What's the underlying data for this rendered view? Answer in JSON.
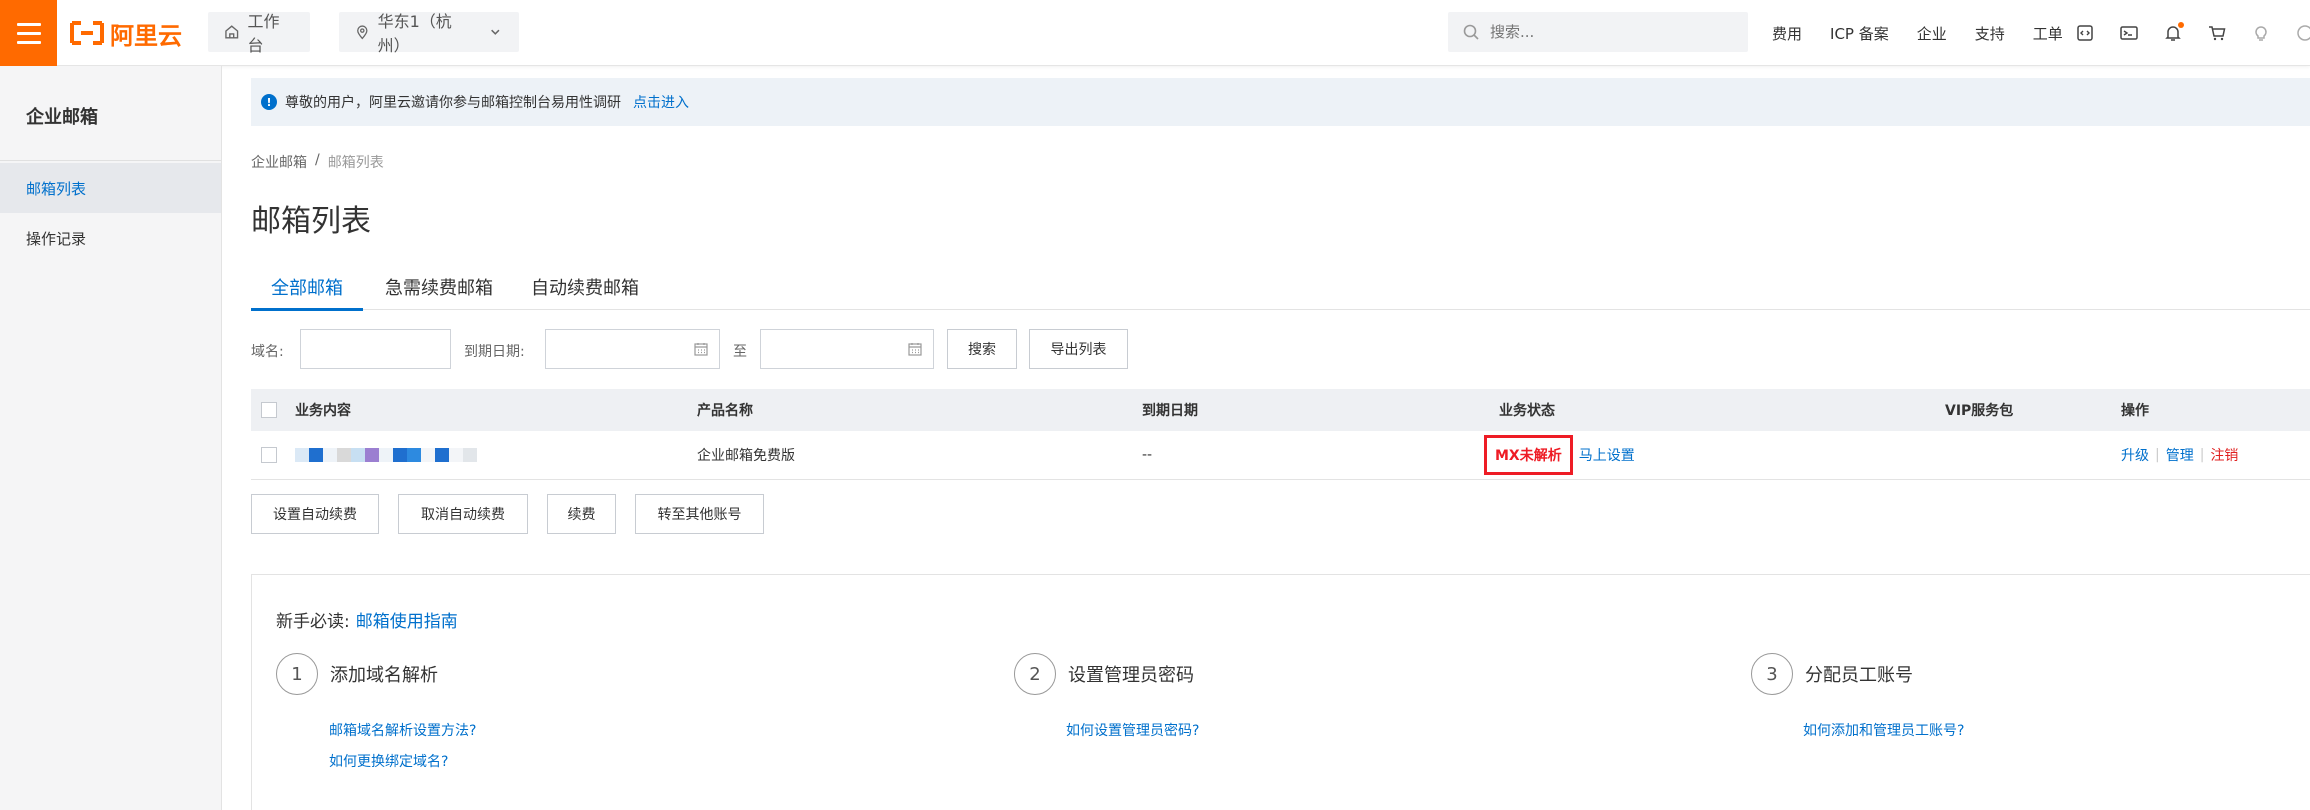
{
  "topbar": {
    "logo_text": "阿里云",
    "workbench": "工作台",
    "region": "华东1（杭州）",
    "search_placeholder": "搜索...",
    "links": [
      "费用",
      "ICP 备案",
      "企业",
      "支持",
      "工单"
    ],
    "icons": [
      "code-icon",
      "terminal-icon",
      "bell-icon",
      "cart-icon",
      "lightbulb-icon",
      "help-icon"
    ]
  },
  "sidebar": {
    "title": "企业邮箱",
    "items": [
      {
        "label": "邮箱列表",
        "active": true
      },
      {
        "label": "操作记录",
        "active": false
      }
    ]
  },
  "notice": {
    "text": "尊敬的用户，阿里云邀请你参与邮箱控制台易用性调研",
    "link": "点击进入"
  },
  "breadcrumb": [
    "企业邮箱",
    "邮箱列表"
  ],
  "page_title": "邮箱列表",
  "tabs": [
    {
      "label": "全部邮箱",
      "active": true
    },
    {
      "label": "急需续费邮箱",
      "active": false
    },
    {
      "label": "自动续费邮箱",
      "active": false
    }
  ],
  "filters": {
    "domain_label": "域名:",
    "domain_value": "",
    "expire_label": "到期日期:",
    "to_label": "至",
    "search_button": "搜索",
    "export_button": "导出列表"
  },
  "table": {
    "columns": [
      "业务内容",
      "产品名称",
      "到期日期",
      "业务状态",
      "VIP服务包",
      "操作"
    ],
    "rows": [
      {
        "product": "企业邮箱免费版",
        "expire": "--",
        "status": "MX未解析",
        "status_action": "马上设置",
        "vip": "",
        "actions": {
          "upgrade": "升级",
          "manage": "管理",
          "cancel": "注销"
        }
      }
    ]
  },
  "bulk_actions": [
    "设置自动续费",
    "取消自动续费",
    "续费",
    "转至其他账号"
  ],
  "guide": {
    "label": "新手必读:",
    "link": "邮箱使用指南",
    "steps": [
      {
        "num": "1",
        "title": "添加域名解析",
        "links": [
          "邮箱域名解析设置方法?",
          "如何更换绑定域名?"
        ]
      },
      {
        "num": "2",
        "title": "设置管理员密码",
        "links": [
          "如何设置管理员密码?"
        ]
      },
      {
        "num": "3",
        "title": "分配员工账号",
        "links": [
          "如何添加和管理员工账号?"
        ]
      }
    ]
  },
  "colors": {
    "brand": "#ff6a00",
    "link": "#0070cc",
    "alert": "#ee1c25"
  }
}
